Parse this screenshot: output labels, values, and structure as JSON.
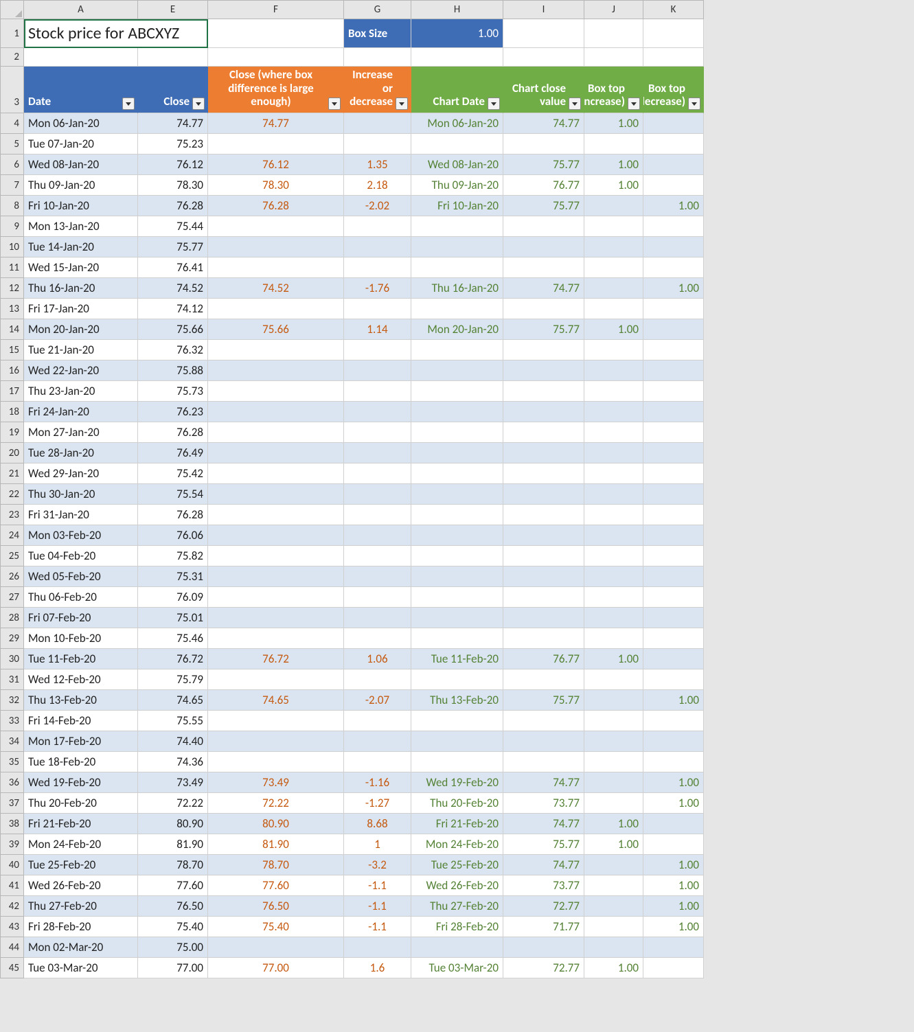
{
  "title": "Stock price for ABCXYZ",
  "box_size_label": "Box Size",
  "box_size_value": "1.00",
  "col_letters": [
    "A",
    "E",
    "F",
    "G",
    "H",
    "I",
    "J",
    "K"
  ],
  "headers": {
    "date": "Date",
    "close": "Close",
    "close_diff": "Close (where box difference is large enough)",
    "incdec": "Increase or decrease",
    "chart_date": "Chart Date",
    "chart_close": "Chart close value",
    "box_inc": "Box top (increase)",
    "box_dec": "Box top (decrease)"
  },
  "chart_data": {
    "type": "table",
    "title": "Stock price for ABCXYZ",
    "box_size": 1.0,
    "columns": [
      "Date",
      "Close",
      "Close (where box difference is large enough)",
      "Increase or decrease",
      "Chart Date",
      "Chart close value",
      "Box top (increase)",
      "Box top (decrease)"
    ],
    "rows": [
      {
        "n": 4,
        "date": "Mon 06-Jan-20",
        "close": "74.77",
        "f": "74.77",
        "g": "",
        "h": "Mon 06-Jan-20",
        "i": "74.77",
        "j": "1.00",
        "k": ""
      },
      {
        "n": 5,
        "date": "Tue 07-Jan-20",
        "close": "75.23",
        "f": "",
        "g": "",
        "h": "",
        "i": "",
        "j": "",
        "k": ""
      },
      {
        "n": 6,
        "date": "Wed 08-Jan-20",
        "close": "76.12",
        "f": "76.12",
        "g": "1.35",
        "h": "Wed 08-Jan-20",
        "i": "75.77",
        "j": "1.00",
        "k": ""
      },
      {
        "n": 7,
        "date": "Thu 09-Jan-20",
        "close": "78.30",
        "f": "78.30",
        "g": "2.18",
        "h": "Thu 09-Jan-20",
        "i": "76.77",
        "j": "1.00",
        "k": ""
      },
      {
        "n": 8,
        "date": "Fri 10-Jan-20",
        "close": "76.28",
        "f": "76.28",
        "g": "-2.02",
        "h": "Fri 10-Jan-20",
        "i": "75.77",
        "j": "",
        "k": "1.00"
      },
      {
        "n": 9,
        "date": "Mon 13-Jan-20",
        "close": "75.44",
        "f": "",
        "g": "",
        "h": "",
        "i": "",
        "j": "",
        "k": ""
      },
      {
        "n": 10,
        "date": "Tue 14-Jan-20",
        "close": "75.77",
        "f": "",
        "g": "",
        "h": "",
        "i": "",
        "j": "",
        "k": ""
      },
      {
        "n": 11,
        "date": "Wed 15-Jan-20",
        "close": "76.41",
        "f": "",
        "g": "",
        "h": "",
        "i": "",
        "j": "",
        "k": ""
      },
      {
        "n": 12,
        "date": "Thu 16-Jan-20",
        "close": "74.52",
        "f": "74.52",
        "g": "-1.76",
        "h": "Thu 16-Jan-20",
        "i": "74.77",
        "j": "",
        "k": "1.00"
      },
      {
        "n": 13,
        "date": "Fri 17-Jan-20",
        "close": "74.12",
        "f": "",
        "g": "",
        "h": "",
        "i": "",
        "j": "",
        "k": ""
      },
      {
        "n": 14,
        "date": "Mon 20-Jan-20",
        "close": "75.66",
        "f": "75.66",
        "g": "1.14",
        "h": "Mon 20-Jan-20",
        "i": "75.77",
        "j": "1.00",
        "k": ""
      },
      {
        "n": 15,
        "date": "Tue 21-Jan-20",
        "close": "76.32",
        "f": "",
        "g": "",
        "h": "",
        "i": "",
        "j": "",
        "k": ""
      },
      {
        "n": 16,
        "date": "Wed 22-Jan-20",
        "close": "75.88",
        "f": "",
        "g": "",
        "h": "",
        "i": "",
        "j": "",
        "k": ""
      },
      {
        "n": 17,
        "date": "Thu 23-Jan-20",
        "close": "75.73",
        "f": "",
        "g": "",
        "h": "",
        "i": "",
        "j": "",
        "k": ""
      },
      {
        "n": 18,
        "date": "Fri 24-Jan-20",
        "close": "76.23",
        "f": "",
        "g": "",
        "h": "",
        "i": "",
        "j": "",
        "k": ""
      },
      {
        "n": 19,
        "date": "Mon 27-Jan-20",
        "close": "76.28",
        "f": "",
        "g": "",
        "h": "",
        "i": "",
        "j": "",
        "k": ""
      },
      {
        "n": 20,
        "date": "Tue 28-Jan-20",
        "close": "76.49",
        "f": "",
        "g": "",
        "h": "",
        "i": "",
        "j": "",
        "k": ""
      },
      {
        "n": 21,
        "date": "Wed 29-Jan-20",
        "close": "75.42",
        "f": "",
        "g": "",
        "h": "",
        "i": "",
        "j": "",
        "k": ""
      },
      {
        "n": 22,
        "date": "Thu 30-Jan-20",
        "close": "75.54",
        "f": "",
        "g": "",
        "h": "",
        "i": "",
        "j": "",
        "k": ""
      },
      {
        "n": 23,
        "date": "Fri 31-Jan-20",
        "close": "76.28",
        "f": "",
        "g": "",
        "h": "",
        "i": "",
        "j": "",
        "k": ""
      },
      {
        "n": 24,
        "date": "Mon 03-Feb-20",
        "close": "76.06",
        "f": "",
        "g": "",
        "h": "",
        "i": "",
        "j": "",
        "k": ""
      },
      {
        "n": 25,
        "date": "Tue 04-Feb-20",
        "close": "75.82",
        "f": "",
        "g": "",
        "h": "",
        "i": "",
        "j": "",
        "k": ""
      },
      {
        "n": 26,
        "date": "Wed 05-Feb-20",
        "close": "75.31",
        "f": "",
        "g": "",
        "h": "",
        "i": "",
        "j": "",
        "k": ""
      },
      {
        "n": 27,
        "date": "Thu 06-Feb-20",
        "close": "76.09",
        "f": "",
        "g": "",
        "h": "",
        "i": "",
        "j": "",
        "k": ""
      },
      {
        "n": 28,
        "date": "Fri 07-Feb-20",
        "close": "75.01",
        "f": "",
        "g": "",
        "h": "",
        "i": "",
        "j": "",
        "k": ""
      },
      {
        "n": 29,
        "date": "Mon 10-Feb-20",
        "close": "75.46",
        "f": "",
        "g": "",
        "h": "",
        "i": "",
        "j": "",
        "k": ""
      },
      {
        "n": 30,
        "date": "Tue 11-Feb-20",
        "close": "76.72",
        "f": "76.72",
        "g": "1.06",
        "h": "Tue 11-Feb-20",
        "i": "76.77",
        "j": "1.00",
        "k": ""
      },
      {
        "n": 31,
        "date": "Wed 12-Feb-20",
        "close": "75.79",
        "f": "",
        "g": "",
        "h": "",
        "i": "",
        "j": "",
        "k": ""
      },
      {
        "n": 32,
        "date": "Thu 13-Feb-20",
        "close": "74.65",
        "f": "74.65",
        "g": "-2.07",
        "h": "Thu 13-Feb-20",
        "i": "75.77",
        "j": "",
        "k": "1.00"
      },
      {
        "n": 33,
        "date": "Fri 14-Feb-20",
        "close": "75.55",
        "f": "",
        "g": "",
        "h": "",
        "i": "",
        "j": "",
        "k": ""
      },
      {
        "n": 34,
        "date": "Mon 17-Feb-20",
        "close": "74.40",
        "f": "",
        "g": "",
        "h": "",
        "i": "",
        "j": "",
        "k": ""
      },
      {
        "n": 35,
        "date": "Tue 18-Feb-20",
        "close": "74.36",
        "f": "",
        "g": "",
        "h": "",
        "i": "",
        "j": "",
        "k": ""
      },
      {
        "n": 36,
        "date": "Wed 19-Feb-20",
        "close": "73.49",
        "f": "73.49",
        "g": "-1.16",
        "h": "Wed 19-Feb-20",
        "i": "74.77",
        "j": "",
        "k": "1.00"
      },
      {
        "n": 37,
        "date": "Thu 20-Feb-20",
        "close": "72.22",
        "f": "72.22",
        "g": "-1.27",
        "h": "Thu 20-Feb-20",
        "i": "73.77",
        "j": "",
        "k": "1.00"
      },
      {
        "n": 38,
        "date": "Fri 21-Feb-20",
        "close": "80.90",
        "f": "80.90",
        "g": "8.68",
        "h": "Fri 21-Feb-20",
        "i": "74.77",
        "j": "1.00",
        "k": ""
      },
      {
        "n": 39,
        "date": "Mon 24-Feb-20",
        "close": "81.90",
        "f": "81.90",
        "g": "1",
        "h": "Mon 24-Feb-20",
        "i": "75.77",
        "j": "1.00",
        "k": ""
      },
      {
        "n": 40,
        "date": "Tue 25-Feb-20",
        "close": "78.70",
        "f": "78.70",
        "g": "-3.2",
        "h": "Tue 25-Feb-20",
        "i": "74.77",
        "j": "",
        "k": "1.00"
      },
      {
        "n": 41,
        "date": "Wed 26-Feb-20",
        "close": "77.60",
        "f": "77.60",
        "g": "-1.1",
        "h": "Wed 26-Feb-20",
        "i": "73.77",
        "j": "",
        "k": "1.00"
      },
      {
        "n": 42,
        "date": "Thu 27-Feb-20",
        "close": "76.50",
        "f": "76.50",
        "g": "-1.1",
        "h": "Thu 27-Feb-20",
        "i": "72.77",
        "j": "",
        "k": "1.00"
      },
      {
        "n": 43,
        "date": "Fri 28-Feb-20",
        "close": "75.40",
        "f": "75.40",
        "g": "-1.1",
        "h": "Fri 28-Feb-20",
        "i": "71.77",
        "j": "",
        "k": "1.00"
      },
      {
        "n": 44,
        "date": "Mon 02-Mar-20",
        "close": "75.00",
        "f": "",
        "g": "",
        "h": "",
        "i": "",
        "j": "",
        "k": ""
      },
      {
        "n": 45,
        "date": "Tue 03-Mar-20",
        "close": "77.00",
        "f": "77.00",
        "g": "1.6",
        "h": "Tue 03-Mar-20",
        "i": "72.77",
        "j": "1.00",
        "k": ""
      }
    ]
  }
}
